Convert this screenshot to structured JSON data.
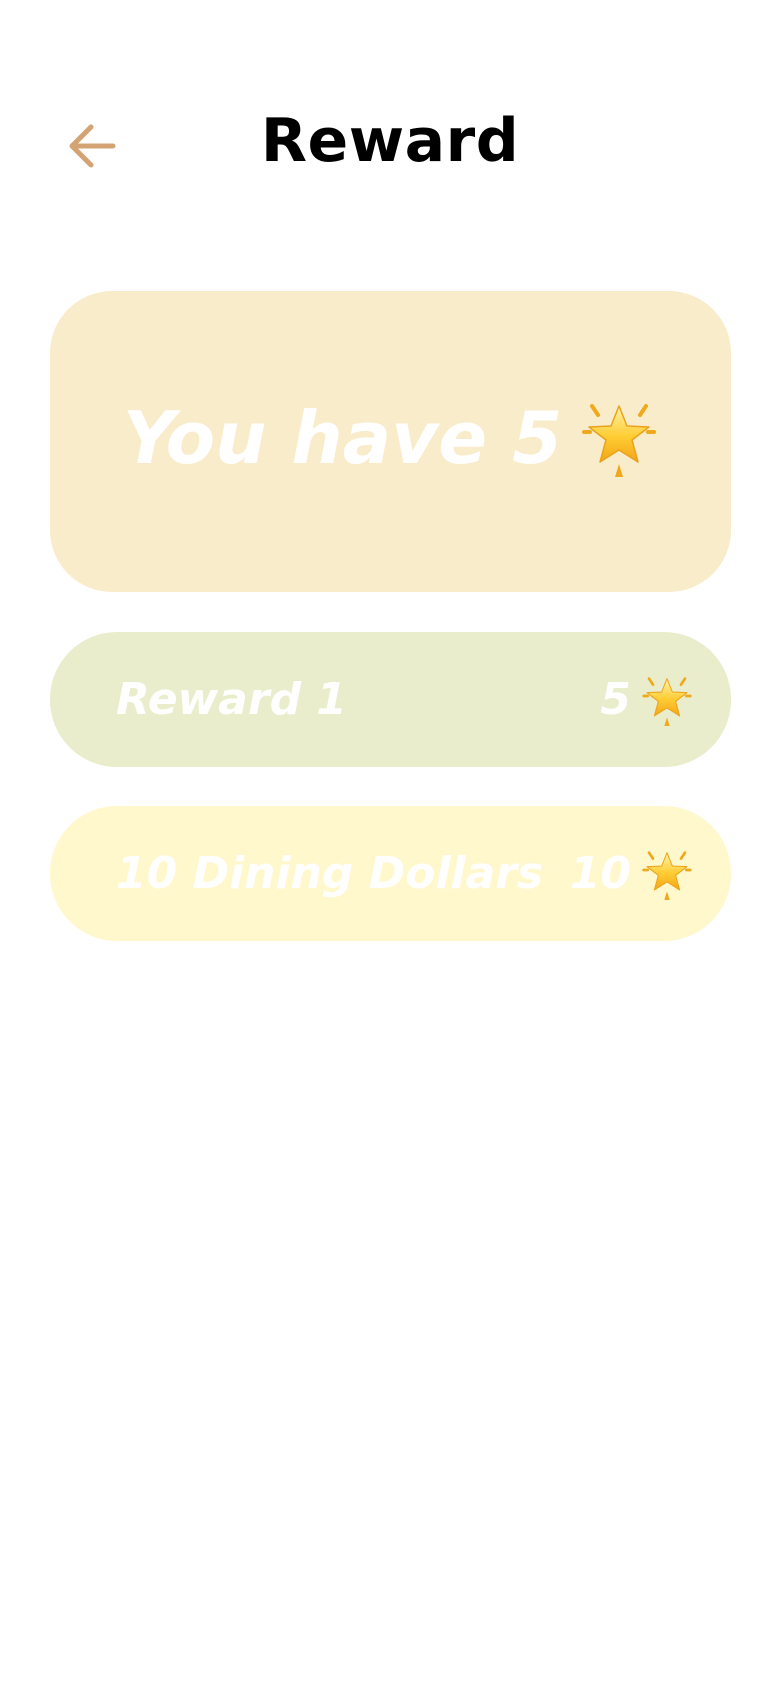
{
  "header": {
    "title": "Reward",
    "back_icon": "arrow-left-icon"
  },
  "balance": {
    "text": "You have 5",
    "icon": "glowing-star-icon"
  },
  "rewards": [
    {
      "name": "Reward 1",
      "cost": "5",
      "icon": "glowing-star-icon",
      "background": "#e9edcb"
    },
    {
      "name": "10 Dining Dollars",
      "cost": "10",
      "icon": "glowing-star-icon",
      "background": "#fff8cc"
    }
  ],
  "colors": {
    "accent": "#d4a373",
    "balance_card": "#f9ecca",
    "text_on_card": "#ffffff"
  }
}
